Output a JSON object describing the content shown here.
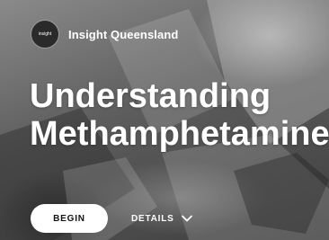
{
  "header": {
    "logo_text": "insight",
    "brand_name": "Insight Queensland"
  },
  "hero": {
    "title_line1": "Understanding",
    "title_line2": "Methamphetamine"
  },
  "actions": {
    "begin_label": "BEGIN",
    "details_label": "DETAILS",
    "details_icon": "chevron-down-icon"
  }
}
